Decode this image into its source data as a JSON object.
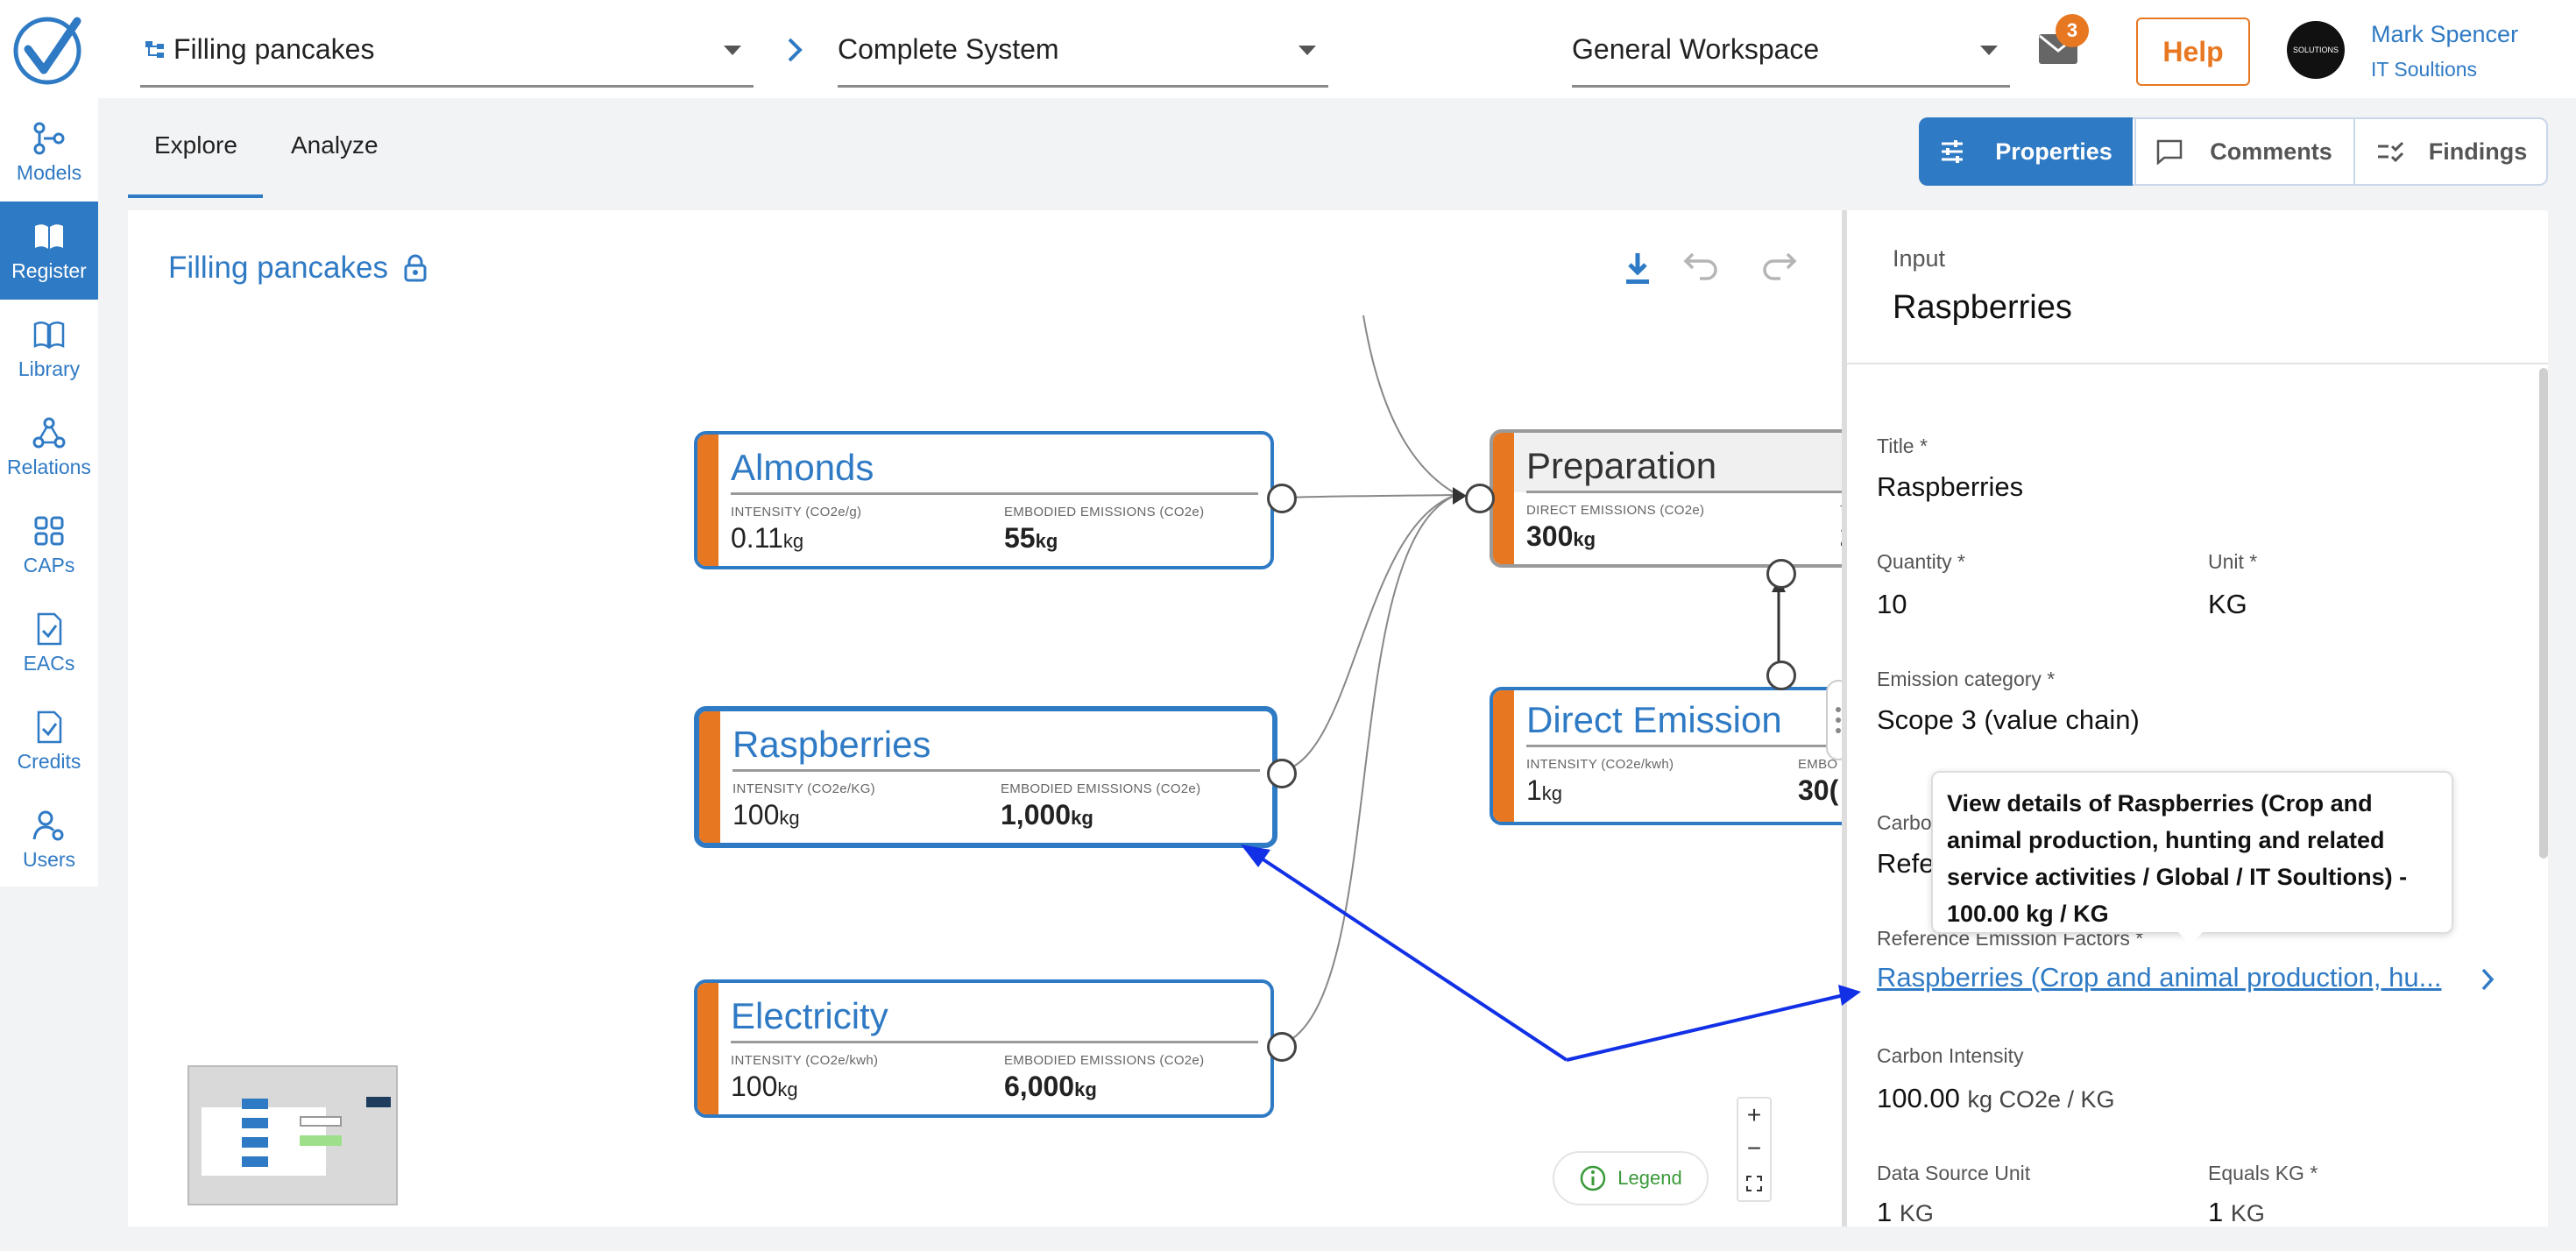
{
  "header": {
    "model_dropdown": "Filling pancakes",
    "system_dropdown": "Complete System",
    "workspace_dropdown": "General Workspace",
    "notification_count": "3",
    "help_label": "Help",
    "user_name": "Mark Spencer",
    "user_org": "IT Soultions",
    "avatar_text": "SOLUTIONS"
  },
  "sidebar": {
    "items": [
      {
        "label": "Models"
      },
      {
        "label": "Register"
      },
      {
        "label": "Library"
      },
      {
        "label": "Relations"
      },
      {
        "label": "CAPs"
      },
      {
        "label": "EACs"
      },
      {
        "label": "Credits"
      },
      {
        "label": "Users"
      }
    ]
  },
  "tabs": [
    "Explore",
    "Analyze"
  ],
  "view_buttons": [
    "Properties",
    "Comments",
    "Findings"
  ],
  "canvas": {
    "title": "Filling pancakes",
    "legend_label": "Legend",
    "nodes": [
      {
        "title": "Almonds",
        "label1": "INTENSITY (CO2e/g)",
        "value1": "0.11",
        "unit1": "kg",
        "label2": "EMBODIED EMISSIONS (CO2e)",
        "value2": "55",
        "unit2": "kg"
      },
      {
        "title": "Raspberries",
        "label1": "INTENSITY (CO2e/KG)",
        "value1": "100",
        "unit1": "kg",
        "label2": "EMBODIED EMISSIONS (CO2e)",
        "value2": "1,000",
        "unit2": "kg"
      },
      {
        "title": "Electricity",
        "label1": "INTENSITY (CO2e/kwh)",
        "value1": "100",
        "unit1": "kg",
        "label2": "EMBODIED EMISSIONS (CO2e)",
        "value2": "6,000",
        "unit2": "kg"
      },
      {
        "title": "Preparation",
        "label1": "DIRECT EMISSIONS (CO2e)",
        "value1": "300",
        "unit1": "kg",
        "label2": "T",
        "value2": "2"
      },
      {
        "title": "Direct Emission",
        "label1": "INTENSITY (CO2e/kwh)",
        "value1": "1",
        "unit1": "kg",
        "label2": "EMBO",
        "value2": "30("
      }
    ]
  },
  "panel": {
    "type_label": "Input",
    "heading": "Raspberries",
    "title_label": "Title *",
    "title_value": "Raspberries",
    "quantity_label": "Quantity *",
    "quantity_value": "10",
    "unit_label": "Unit *",
    "unit_value": "KG",
    "emission_category_label": "Emission category *",
    "emission_category_value": "Scope 3 (value chain)",
    "carbon_label_partial": "Carbo",
    "carbon_value_partial": "Refe",
    "ref_factors_label": "Reference Emission Factors *",
    "ref_factors_link": "Raspberries (Crop and animal production, hu...",
    "carbon_intensity_label": "Carbon Intensity",
    "carbon_intensity_value": "100.00",
    "carbon_intensity_unit": "kg CO2e / KG",
    "data_source_unit_label": "Data Source Unit",
    "data_source_unit_num": "1",
    "data_source_unit_value": "KG",
    "equals_kg_label": "Equals KG *",
    "equals_kg_num": "1",
    "equals_kg_value": "KG"
  },
  "tooltip": {
    "text": "View details of Raspberries (Crop and animal production, hunting and related service activities / Global / IT Soultions) - 100.00 kg / KG"
  },
  "colors": {
    "accent_blue": "#2f7ac4",
    "accent_orange": "#e87722",
    "annotation_blue": "#1230e6"
  }
}
